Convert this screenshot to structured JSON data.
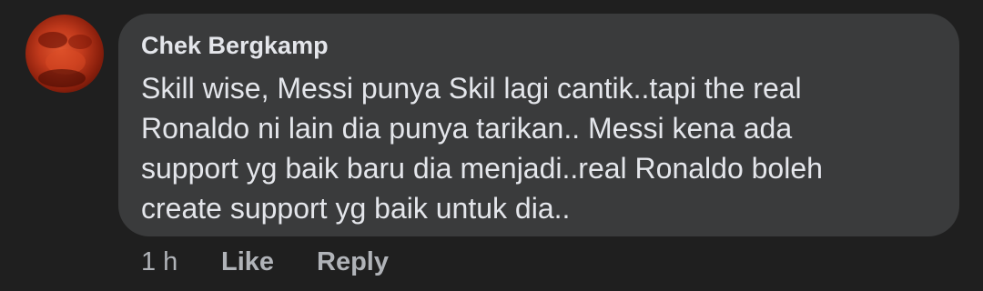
{
  "comment": {
    "author": "Chek Bergkamp",
    "text_lines": [
      "Skill wise, Messi punya Skil lagi cantik..tapi the real",
      "Ronaldo ni lain dia punya tarikan.. Messi kena ada",
      "support yg baik baru dia menjadi..real Ronaldo boleh",
      "create support yg baik untuk dia.."
    ],
    "timestamp": "1 h",
    "actions": {
      "like_label": "Like",
      "reply_label": "Reply"
    }
  },
  "colors": {
    "background": "#1f1f1f",
    "bubble": "#3a3b3c",
    "primary_text": "#e4e6eb",
    "secondary_text": "#b0b3b8"
  },
  "icons": {
    "avatar": "profile-photo"
  }
}
